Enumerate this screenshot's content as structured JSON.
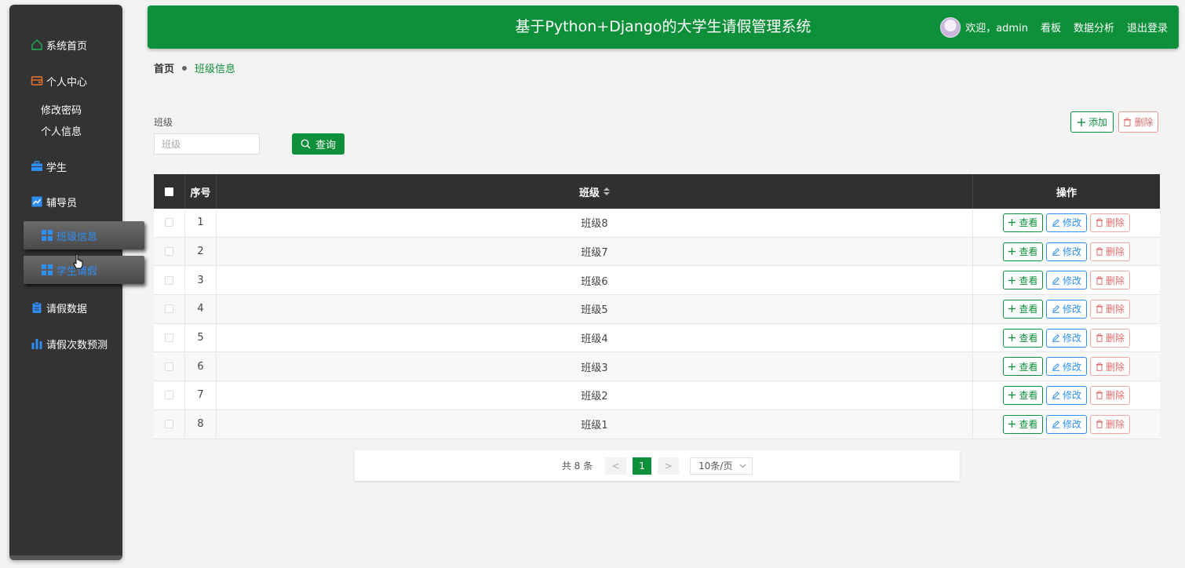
{
  "header": {
    "title": "基于Python+Django的大学生请假管理系统",
    "welcome": "欢迎，admin",
    "links": [
      "看板",
      "数据分析",
      "退出登录"
    ],
    "color": "#0e8f3a"
  },
  "sidebar": {
    "items": [
      {
        "label": "系统首页",
        "icon": "home-icon"
      },
      {
        "label": "个人中心",
        "icon": "wallet-icon"
      },
      {
        "label": "学生",
        "icon": "briefcase-icon"
      },
      {
        "label": "辅导员",
        "icon": "chart-icon"
      },
      {
        "label": "班级信息",
        "icon": "grid-icon",
        "active": true
      },
      {
        "label": "学生请假",
        "icon": "grid-icon",
        "active": true
      },
      {
        "label": "请假数据",
        "icon": "clipboard-icon"
      },
      {
        "label": "请假次数预测",
        "icon": "bar-chart-icon"
      }
    ],
    "submenu": [
      "修改密码",
      "个人信息"
    ]
  },
  "breadcrumb": {
    "home": "首页",
    "current": "班级信息"
  },
  "search": {
    "label": "班级",
    "placeholder": "班级",
    "value": "",
    "button": "查询"
  },
  "toolbar": {
    "add": "添加",
    "delete": "删除"
  },
  "table": {
    "headers": {
      "index": "序号",
      "class": "班级",
      "actions": "操作"
    },
    "rows": [
      {
        "index": "1",
        "class": "班级8"
      },
      {
        "index": "2",
        "class": "班级7"
      },
      {
        "index": "3",
        "class": "班级6"
      },
      {
        "index": "4",
        "class": "班级5"
      },
      {
        "index": "5",
        "class": "班级4"
      },
      {
        "index": "6",
        "class": "班级3"
      },
      {
        "index": "7",
        "class": "班级2"
      },
      {
        "index": "8",
        "class": "班级1"
      }
    ],
    "actions": {
      "view": "查看",
      "edit": "修改",
      "delete": "删除"
    }
  },
  "pagination": {
    "total": "共 8 条",
    "prev": "<",
    "page": "1",
    "next": ">",
    "size": "10条/页"
  }
}
